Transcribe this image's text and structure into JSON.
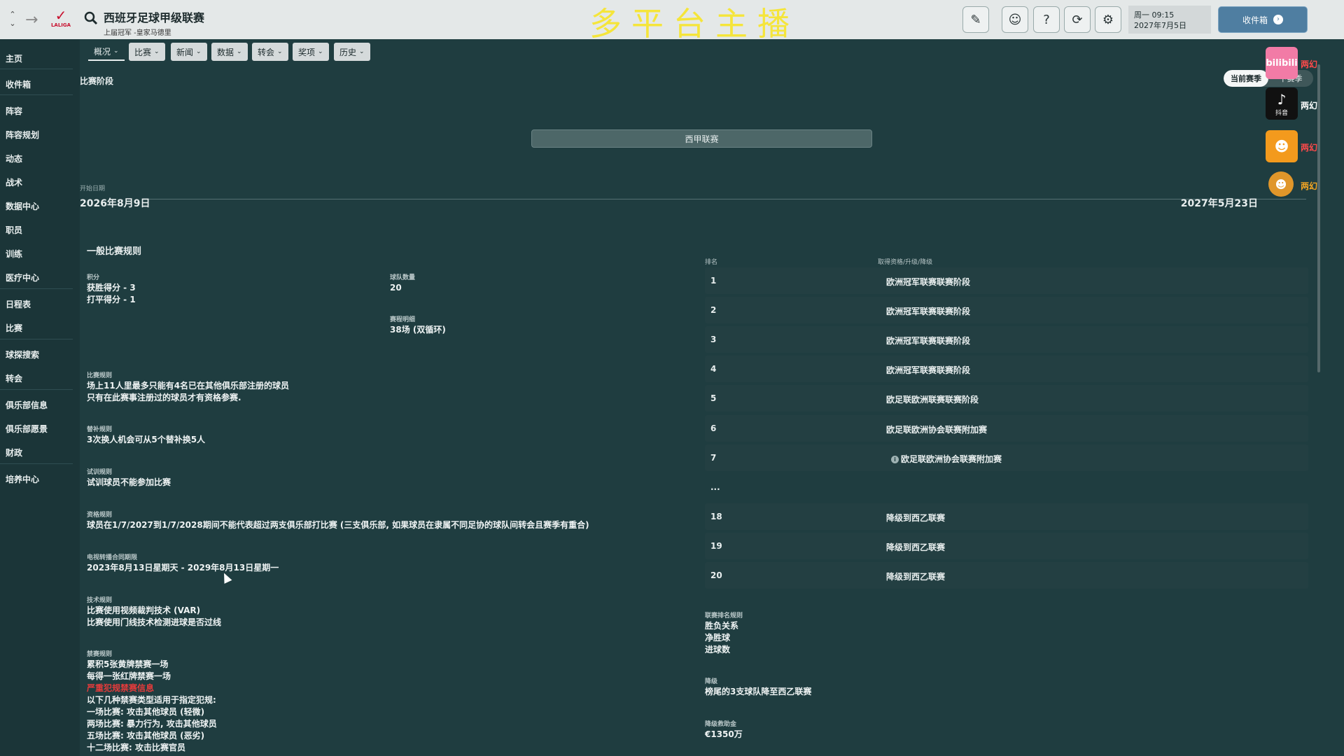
{
  "topbar": {
    "league_logo_text": "LALIGA",
    "title": "西班牙足球甲级联赛",
    "subtitle": "上届冠军 -皇家马德里",
    "stream_banner": "多平台主播",
    "date_line1": "周一 09:15",
    "date_line2": "2027年7月5日",
    "inbox_label": "收件箱"
  },
  "sidebar": {
    "items": [
      "主页",
      "收件箱",
      "阵容",
      "阵容规划",
      "动态",
      "战术",
      "数据中心",
      "职员",
      "训练",
      "医疗中心",
      "日程表",
      "比赛",
      "球探搜索",
      "转会",
      "俱乐部信息",
      "俱乐部愿景",
      "财政",
      "培养中心"
    ]
  },
  "tabs": [
    {
      "label": "概况"
    },
    {
      "label": "比赛"
    },
    {
      "label": "新闻"
    },
    {
      "label": "数据"
    },
    {
      "label": "转会"
    },
    {
      "label": "奖项"
    },
    {
      "label": "历史"
    }
  ],
  "stage": {
    "label": "比赛阶段",
    "bar_label": "西甲联赛",
    "start_label": "开始日期",
    "start_date": "2026年8月9日",
    "end_date": "2027年5月23日",
    "season_current": "当前赛季",
    "season_next": "下赛季"
  },
  "rules": {
    "section_title": "一般比赛规则",
    "points_label": "积分",
    "points_win": "获胜得分 - 3",
    "points_draw": "打平得分 - 1",
    "teams_label": "球队数量",
    "teams_value": "20",
    "schedule_label": "赛程明细",
    "schedule_value": "38场 (双循环)",
    "match_rules_label": "比赛规则",
    "match_rules_1": "场上11人里最多只能有4名已在其他俱乐部注册的球员",
    "match_rules_2": "只有在此赛事注册过的球员才有资格参赛.",
    "subs_label": "替补规则",
    "subs_value": "3次换人机会可从5个替补换5人",
    "trial_label": "试训规则",
    "trial_value": "试训球员不能参加比赛",
    "eligibility_label": "资格规则",
    "eligibility_value": "球员在1/7/2027到1/7/2028期间不能代表超过两支俱乐部打比赛 (三支俱乐部, 如果球员在隶属不同足协的球队间转会且赛季有重合)",
    "tv_label": "电视转播合同期限",
    "tv_value": "2023年8月13日星期天 - 2029年8月13日星期一",
    "tech_label": "技术规则",
    "tech_1": "比赛使用视频裁判技术 (VAR)",
    "tech_2": "比赛使用门线技术检测进球是否过线",
    "ban_label": "禁赛规则",
    "ban_1": "累积5张黄牌禁赛一场",
    "ban_2": "每得一张红牌禁赛一场",
    "ban_3": "严重犯规禁赛信息",
    "ban_4": "以下几种禁赛类型适用于指定犯规:",
    "ban_5": "一场比赛: 攻击其他球员 (轻微)",
    "ban_6": "两场比赛: 暴力行为, 攻击其他球员",
    "ban_7": "五场比赛: 攻击其他球员 (恶劣)",
    "ban_8": "十二场比赛: 攻击比赛官员"
  },
  "table": {
    "col_rank": "排名",
    "col_qual": "取得资格/升级/降级",
    "rows": [
      {
        "rank": "1",
        "qual": "欧洲冠军联赛联赛阶段"
      },
      {
        "rank": "2",
        "qual": "欧洲冠军联赛联赛阶段"
      },
      {
        "rank": "3",
        "qual": "欧洲冠军联赛联赛阶段"
      },
      {
        "rank": "4",
        "qual": "欧洲冠军联赛联赛阶段"
      },
      {
        "rank": "5",
        "qual": "欧足联欧洲联赛联赛阶段"
      },
      {
        "rank": "6",
        "qual": "欧足联欧洲协会联赛附加赛"
      },
      {
        "rank": "7",
        "qual": "欧足联欧洲协会联赛附加赛"
      },
      {
        "rank": "...",
        "qual": ""
      },
      {
        "rank": "18",
        "qual": "降级到西乙联赛"
      },
      {
        "rank": "19",
        "qual": "降级到西乙联赛"
      },
      {
        "rank": "20",
        "qual": "降级到西乙联赛"
      }
    ]
  },
  "league_rank": {
    "label": "联赛排名规则",
    "item1": "胜负关系",
    "item2": "净胜球",
    "item3": "进球数"
  },
  "relegation": {
    "label": "降级",
    "value": "榜尾的3支球队降至西乙联赛"
  },
  "parachute": {
    "label": "降级救助金",
    "value": "€1350万"
  },
  "overlay": {
    "bili_text": "bilibili",
    "bili_name": "两幻",
    "tiktok_text": "抖音",
    "tiktok_name": "两幻",
    "kuai_name": "两幻",
    "other_name": "两幻"
  }
}
